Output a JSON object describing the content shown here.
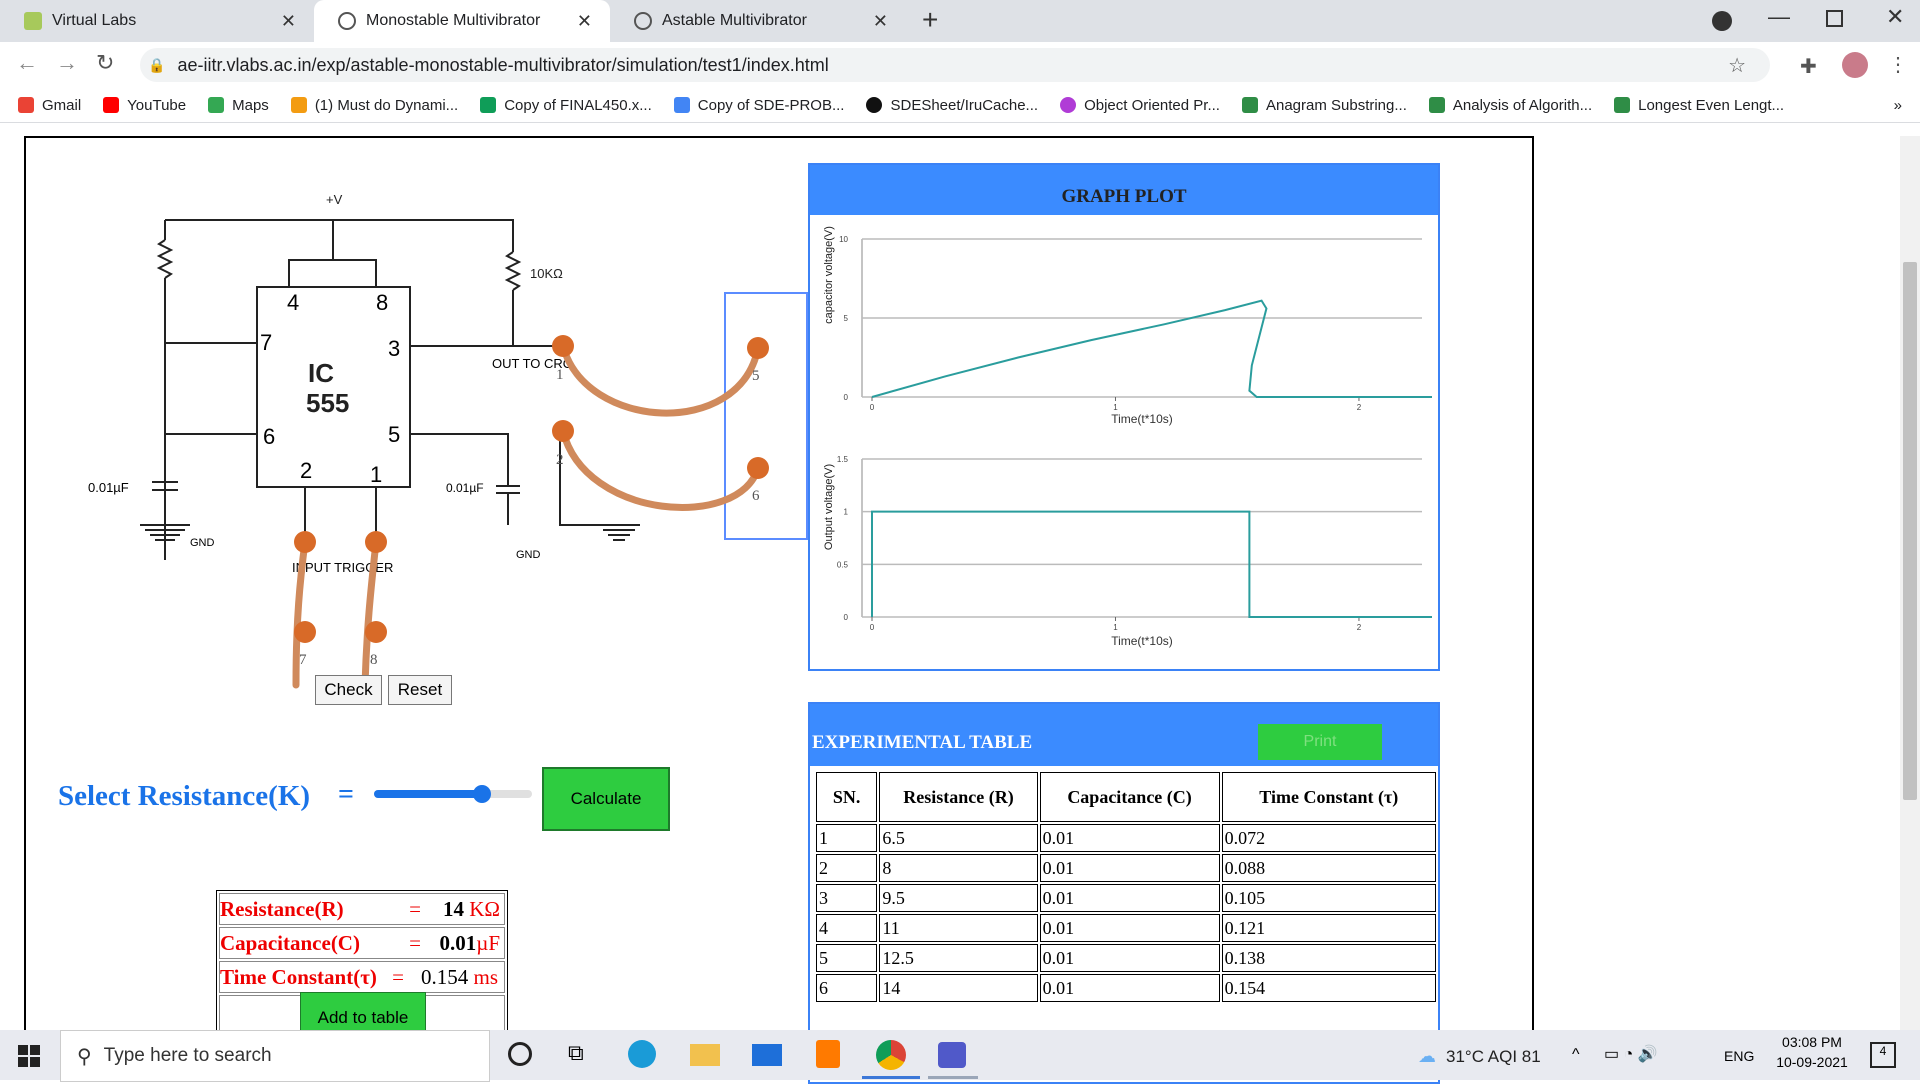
{
  "browser": {
    "tabs": [
      {
        "title": "Virtual Labs"
      },
      {
        "title": "Monostable Multivibrator"
      },
      {
        "title": "Astable Multivibrator"
      }
    ],
    "url": "ae-iitr.vlabs.ac.in/exp/astable-monostable-multivibrator/simulation/test1/index.html",
    "bookmarks": [
      "Gmail",
      "YouTube",
      "Maps",
      "(1) Must do Dynami...",
      "Copy of FINAL450.x...",
      "Copy of SDE-PROB...",
      "SDESheet/IruCache...",
      "Object Oriented Pr...",
      "Anagram Substring...",
      "Analysis of Algorith...",
      "Longest Even Lengt..."
    ],
    "more": "»"
  },
  "circuit": {
    "vplus": "+V",
    "r_label": "10KΩ",
    "ic_name_1": "IC",
    "ic_name_2": "555",
    "pins": {
      "p4": "4",
      "p8": "8",
      "p7": "7",
      "p3": "3",
      "p6": "6",
      "p5": "5",
      "p2": "2",
      "p1": "1"
    },
    "cap_left": "0.01µF",
    "cap_right": "0.01µF",
    "gnd_left": "GND",
    "gnd_right": "GND",
    "out_to_cro": "OUT TO CRO",
    "input_trigger": "INPUT TRIGGER",
    "nodes": {
      "n1": "1",
      "n2": "2",
      "n5": "5",
      "n6": "6",
      "n7": "7",
      "n8": "8"
    },
    "check": "Check",
    "reset": "Reset"
  },
  "graph": {
    "title": "GRAPH PLOT",
    "cap_ylabel": "capacitor voltage(V)",
    "out_ylabel": "Output voltage(V)",
    "xlabel": "Time(t*10s)",
    "cap_yticks": [
      "10",
      "5",
      "0"
    ],
    "out_yticks": [
      "1.5",
      "1",
      "0.5",
      "0"
    ],
    "xticks": [
      "0",
      "1",
      "2"
    ]
  },
  "chart_data": [
    {
      "type": "line",
      "title": "",
      "xlabel": "Time(t*10s)",
      "ylabel": "capacitor voltage(V)",
      "xlim": [
        0,
        2.3
      ],
      "ylim": [
        0,
        10
      ],
      "series": [
        {
          "x": [
            0,
            0.3,
            0.6,
            0.9,
            1.2,
            1.45,
            1.6,
            1.62,
            1.56,
            1.55,
            1.58,
            2.3
          ],
          "values": [
            0,
            1.3,
            2.5,
            3.6,
            4.6,
            5.5,
            6.1,
            5.6,
            2.0,
            0.4,
            0.0,
            0.0
          ]
        }
      ],
      "color": "#2a9d9d"
    },
    {
      "type": "line",
      "title": "",
      "xlabel": "Time(t*10s)",
      "ylabel": "Output voltage(V)",
      "xlim": [
        0,
        2.3
      ],
      "ylim": [
        0,
        1.5
      ],
      "series": [
        {
          "x": [
            0,
            0,
            1.55,
            1.55,
            2.3
          ],
          "values": [
            0,
            1,
            1,
            0,
            0
          ]
        }
      ],
      "color": "#2a9d9d"
    }
  ],
  "controls": {
    "select_label": "Select Resistance(K)",
    "equals": "=",
    "slider_value": 14,
    "slider_min": 1,
    "slider_max": 20,
    "calculate": "Calculate"
  },
  "results": {
    "r_label": "Resistance(R)",
    "r_value": "14",
    "r_unit": "KΩ",
    "c_label": "Capacitance(C)",
    "c_value": "0.01",
    "c_unit": "µF",
    "t_label": "Time Constant(τ)",
    "t_value": "0.154",
    "t_unit": "ms",
    "eq": "=",
    "add": "Add to table"
  },
  "table": {
    "title": "EXPERIMENTAL TABLE",
    "print": "Print",
    "headers": [
      "SN.",
      "Resistance (R)",
      "Capacitance (C)",
      "Time Constant (τ)"
    ],
    "rows": [
      [
        "1",
        "6.5",
        "0.01",
        "0.072"
      ],
      [
        "2",
        "8",
        "0.01",
        "0.088"
      ],
      [
        "3",
        "9.5",
        "0.01",
        "0.105"
      ],
      [
        "4",
        "11",
        "0.01",
        "0.121"
      ],
      [
        "5",
        "12.5",
        "0.01",
        "0.138"
      ],
      [
        "6",
        "14",
        "0.01",
        "0.154"
      ]
    ]
  },
  "taskbar": {
    "search_placeholder": "Type here to search",
    "weather": "31°C AQI 81",
    "lang": "ENG",
    "time": "03:08 PM",
    "date": "10-09-2021",
    "notif": "4"
  }
}
